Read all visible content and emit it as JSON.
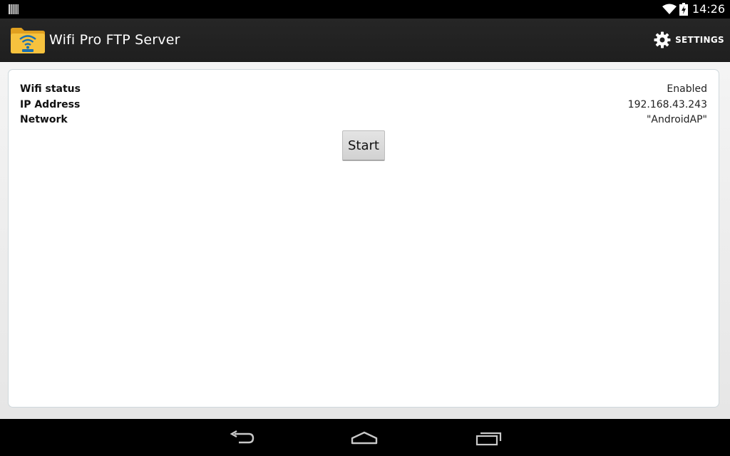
{
  "status_bar": {
    "time": "14:26",
    "icons": [
      "notification-icon",
      "wifi-icon",
      "battery-charging-icon"
    ]
  },
  "action_bar": {
    "title": "Wifi Pro FTP Server",
    "app_icon": "ftp-folder-wifi-icon",
    "settings_label": "SETTINGS",
    "settings_icon": "gear-icon"
  },
  "info": {
    "rows": [
      {
        "label": "Wifi status",
        "value": "Enabled"
      },
      {
        "label": "IP Address",
        "value": "192.168.43.243"
      },
      {
        "label": "Network",
        "value": "\"AndroidAP\""
      }
    ]
  },
  "start_button": {
    "label": "Start"
  },
  "nav_bar": {
    "icons": [
      "back-icon",
      "home-icon",
      "recent-apps-icon"
    ]
  },
  "colors": {
    "action_bar_bg": "#222222",
    "content_bg": "#eeeeee",
    "card_border": "#cfd8dc",
    "button_bg": "#dcdcdc"
  }
}
